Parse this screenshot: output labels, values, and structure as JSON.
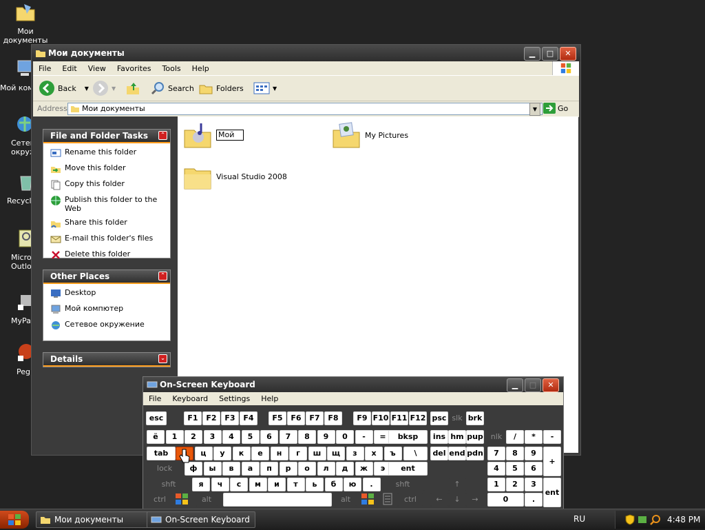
{
  "desktop": {
    "icons": [
      {
        "label": "Мои\nдокументы"
      },
      {
        "label": "Мой комп"
      },
      {
        "label": "Сетев\nокруже"
      },
      {
        "label": "Recycl"
      },
      {
        "label": "Micros\nOutlo"
      },
      {
        "label": "MyPa"
      },
      {
        "label": "Peg"
      }
    ]
  },
  "explorer": {
    "title": "Мои документы",
    "menu": [
      "File",
      "Edit",
      "View",
      "Favorites",
      "Tools",
      "Help"
    ],
    "toolbar": {
      "back_label": "Back",
      "search_label": "Search",
      "folders_label": "Folders"
    },
    "address": {
      "label": "Address",
      "value": "Мои документы",
      "go_label": "Go"
    },
    "panels": {
      "file_tasks": {
        "title": "File and Folder Tasks",
        "items": [
          "Rename this folder",
          "Move this folder",
          "Copy this folder",
          "Publish this folder to the Web",
          "Share this folder",
          "E-mail this folder's files",
          "Delete this folder"
        ]
      },
      "other_places": {
        "title": "Other Places",
        "items": [
          "Desktop",
          "Мой компютер",
          "Сетевое окружение"
        ]
      },
      "details": {
        "title": "Details"
      }
    },
    "folders": [
      {
        "name": "Мой",
        "renaming": true
      },
      {
        "name": "My Pictures"
      },
      {
        "name": "Visual Studio 2008"
      }
    ]
  },
  "osk": {
    "title": "On-Screen Keyboard",
    "menu": [
      "File",
      "Keyboard",
      "Settings",
      "Help"
    ],
    "rows": {
      "r0": [
        "esc",
        "F1",
        "F2",
        "F3",
        "F4",
        "F5",
        "F6",
        "F7",
        "F8",
        "F9",
        "F10",
        "F11",
        "F12",
        "psc",
        "slk",
        "brk"
      ],
      "r1": [
        "ё",
        "1",
        "2",
        "3",
        "4",
        "5",
        "6",
        "7",
        "8",
        "9",
        "0",
        "-",
        "=",
        "bksp",
        "ins",
        "hm",
        "pup",
        "nlk",
        "/",
        "*",
        "-"
      ],
      "r2": [
        "tab",
        "й",
        "ц",
        "у",
        "к",
        "е",
        "н",
        "г",
        "ш",
        "щ",
        "з",
        "х",
        "ъ",
        "\\",
        "del",
        "end",
        "pdn",
        "7",
        "8",
        "9",
        "+"
      ],
      "r3": [
        "lock",
        "ф",
        "ы",
        "в",
        "а",
        "п",
        "р",
        "о",
        "л",
        "д",
        "ж",
        "э",
        "ent",
        "4",
        "5",
        "6"
      ],
      "r4": [
        "shft",
        "я",
        "ч",
        "с",
        "м",
        "и",
        "т",
        "ь",
        "б",
        "ю",
        ".",
        "shft",
        "↑",
        "1",
        "2",
        "3",
        "ent"
      ],
      "r5": [
        "ctrl",
        "alt",
        "alt",
        "ctrl",
        "←",
        "↓",
        "→",
        "0",
        "."
      ]
    }
  },
  "taskbar": {
    "tasks": [
      "Мои документы",
      "On-Screen Keyboard"
    ],
    "lang": "RU",
    "clock": "4:48 PM"
  }
}
